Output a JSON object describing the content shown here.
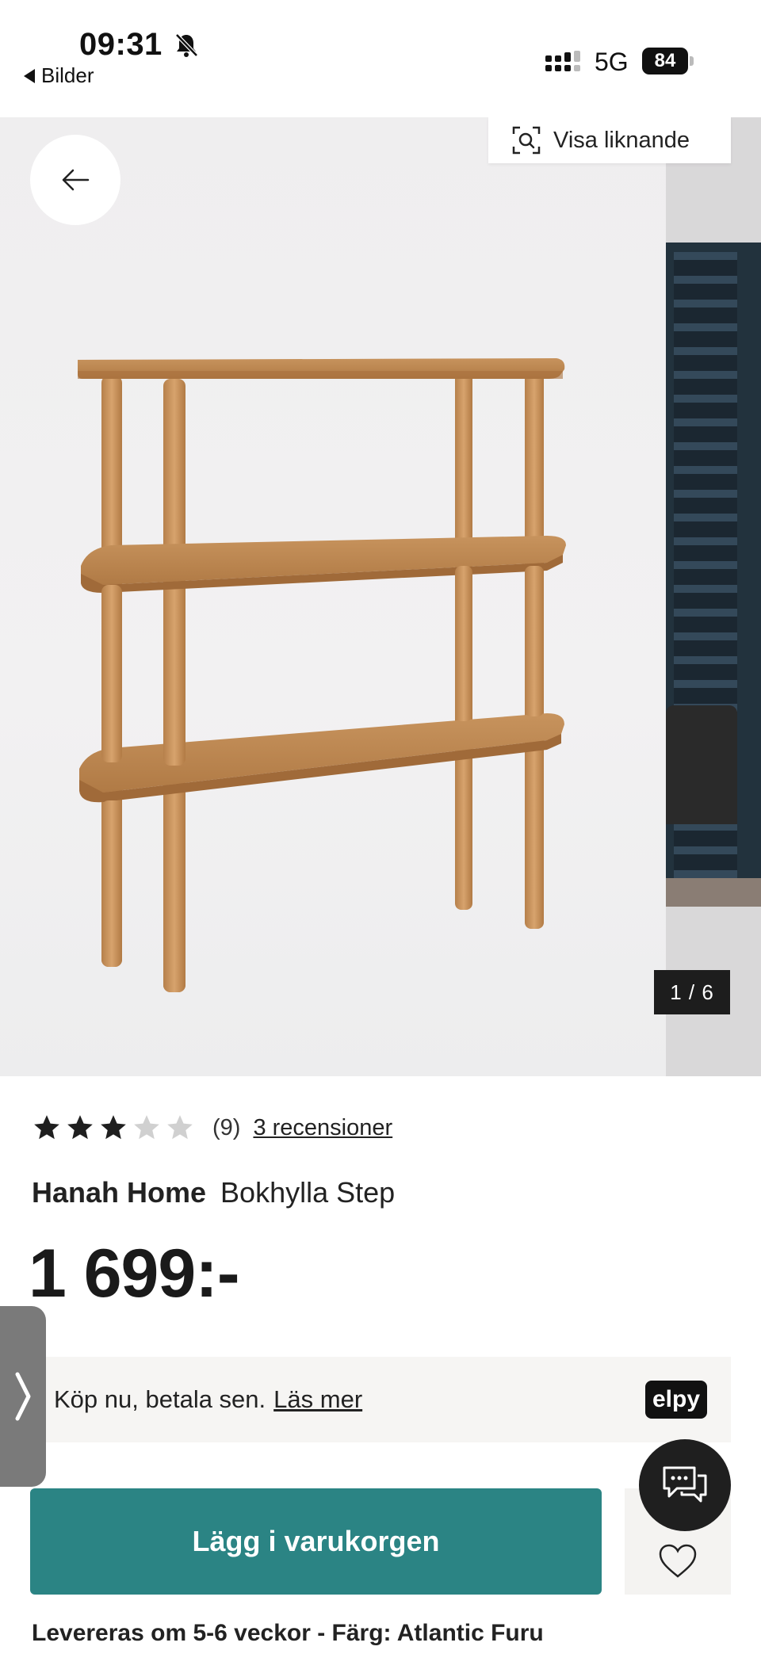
{
  "status_bar": {
    "time": "09:31",
    "back_app": "Bilder",
    "network": "5G",
    "battery": "84"
  },
  "gallery": {
    "similar_label": "Visa liknande",
    "counter": "1 / 6"
  },
  "product": {
    "rating": {
      "stars_filled": 3,
      "stars_total": 5,
      "count": "(9)",
      "reviews_link": "3 recensioner"
    },
    "brand": "Hanah Home",
    "name": "Bokhylla Step",
    "price": "1 699:-"
  },
  "paylater": {
    "text": "Köp nu, betala sen.",
    "link": "Läs mer",
    "logo": "elpy"
  },
  "actions": {
    "add_to_cart": "Lägg i varukorgen"
  },
  "delivery": "Levereras om 5-6 veckor - Färg: Atlantic Furu",
  "colors": {
    "accent": "#2b8484",
    "star_filled": "#1f1f1f",
    "star_empty": "#d0d0d0"
  }
}
